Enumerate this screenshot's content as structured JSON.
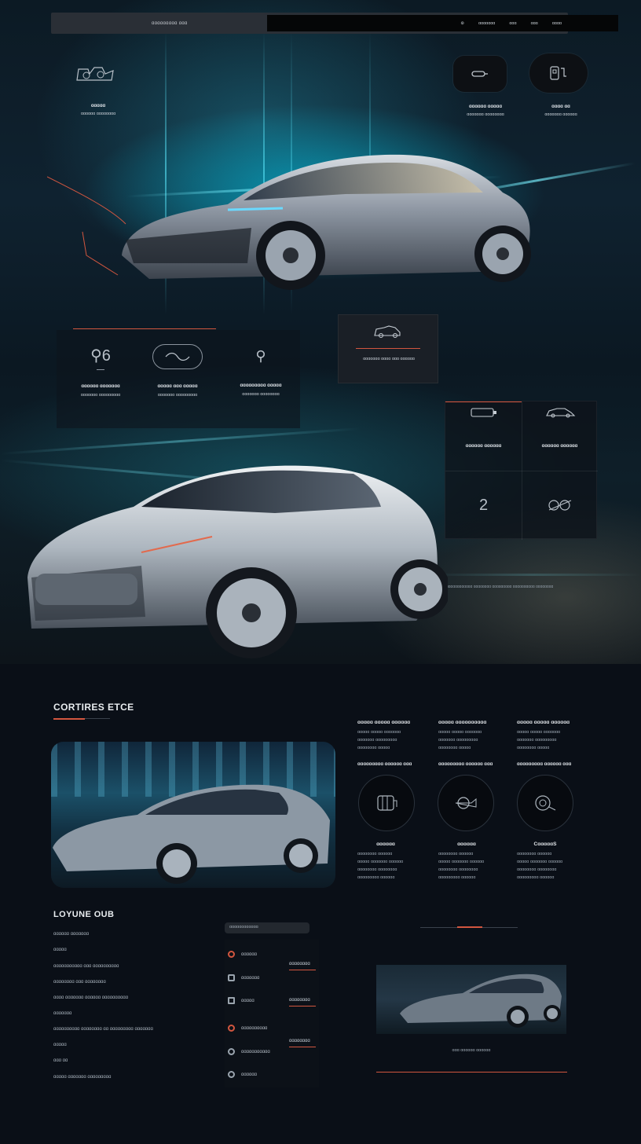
{
  "header": {
    "brand": "ɑɑɑɑɑɑɑɑɑ ɑɑɑ",
    "nav": [
      "ɑɑɑɑɑɑɑ",
      "ɑɑɑ",
      "ɑɑɑ",
      "ɑɑɑɑ"
    ]
  },
  "hero": {
    "top_left_feature": {
      "title": "ɑɑɑɑɑ",
      "desc": "ɑɑɑɑɑɑ ɑɑɑɑɑɑɑɑ"
    },
    "top_right_features": [
      {
        "title": "ɑɑɑɑɑɑ ɑɑɑɑɑ",
        "desc": "ɑɑɑɑɑɑɑ ɑɑɑɑɑɑɑɑ"
      },
      {
        "title": "ɑɑɑɑ ɑɑ",
        "desc": "ɑɑɑɑɑɑɑ ɑɑɑɑɑɑ"
      }
    ],
    "stat_features": [
      {
        "icon_text": "6",
        "title": "ɑɑɑɑɑɑ ɑɑɑɑɑɑɑ",
        "desc": "ɑɑɑɑɑɑɑ ɑɑɑɑɑɑɑɑɑ"
      },
      {
        "icon_text": "",
        "title": "ɑɑɑɑɑ ɑɑɑ ɑɑɑɑɑ",
        "desc": "ɑɑɑɑɑɑɑ ɑɑɑɑɑɑɑɑɑ"
      },
      {
        "icon_text": "",
        "title": "ɑɑɑɑɑɑɑɑɑ ɑɑɑɑɑ",
        "desc": "ɑɑɑɑɑɑɑ ɑɑɑɑɑɑɑɑ"
      }
    ],
    "mid_panel_text": "ɑɑɑɑɑɑɑ ɑɑɑɑ ɑɑɑ ɑɑɑɑɑɑ",
    "spec_panel": [
      {
        "title": "ɑɑɑɑɑɑ ɑɑɑɑɑɑ"
      },
      {
        "title": "ɑɑɑɑɑɑ ɑɑɑɑɑɑ"
      },
      {
        "value": "2"
      }
    ],
    "ticker": "ɑɑɑɑɑɑɑɑɑɑɑɑ ɑɑɑɑɑɑɑɑ ɑɑɑɑɑɑɑɑɑ ɑɑɑɑɑɑɑɑɑɑ ɑɑɑɑɑɑɑɑ"
  },
  "section_features": {
    "title": "CORTIRES ETCE",
    "columns_top": [
      {
        "title": "ɑɑɑɑɑ ɑɑɑɑɑ ɑɑɑɑɑɑ",
        "lines": [
          "ɑɑɑɑɑ ɑɑɑɑɑ ɑɑɑɑɑɑɑ",
          "ɑɑɑɑɑɑɑ ɑɑɑɑɑɑɑɑɑ",
          "ɑɑɑɑɑɑɑɑ ɑɑɑɑɑ"
        ]
      },
      {
        "title": "ɑɑɑɑɑ ɑɑɑɑɑɑɑɑɑɑ",
        "lines": [
          "ɑɑɑɑɑ ɑɑɑɑɑ ɑɑɑɑɑɑɑ",
          "ɑɑɑɑɑɑɑ ɑɑɑɑɑɑɑɑɑ",
          "ɑɑɑɑɑɑɑɑ ɑɑɑɑɑ"
        ]
      },
      {
        "title": "ɑɑɑɑɑ ɑɑɑɑɑ ɑɑɑɑɑɑ",
        "lines": [
          "ɑɑɑɑɑ ɑɑɑɑɑ ɑɑɑɑɑɑɑ",
          "ɑɑɑɑɑɑɑ ɑɑɑɑɑɑɑɑɑ",
          "ɑɑɑɑɑɑɑɑ ɑɑɑɑɑ"
        ]
      }
    ],
    "columns_mid": [
      "ɑɑɑɑɑɑɑɑɑ ɑɑɑɑɑɑ ɑɑɑ",
      "ɑɑɑɑɑɑɑɑɑ ɑɑɑɑɑɑ ɑɑɑ",
      "ɑɑɑɑɑɑɑɑɑ ɑɑɑɑɑɑ ɑɑɑ"
    ],
    "columns_bottom": [
      {
        "title": "ɑɑɑɑɑɑ",
        "lines": [
          "ɑɑɑɑɑɑɑɑ ɑɑɑɑɑɑ",
          "ɑɑɑɑɑ ɑɑɑɑɑɑɑ ɑɑɑɑɑɑ",
          "ɑɑɑɑɑɑɑɑ ɑɑɑɑɑɑɑɑ",
          "ɑɑɑɑɑɑɑɑɑ ɑɑɑɑɑɑ"
        ]
      },
      {
        "title": "ɑɑɑɑɑɑ",
        "lines": [
          "ɑɑɑɑɑɑɑɑ ɑɑɑɑɑɑ",
          "ɑɑɑɑɑ ɑɑɑɑɑɑɑ ɑɑɑɑɑɑ",
          "ɑɑɑɑɑɑɑɑ ɑɑɑɑɑɑɑɑ",
          "ɑɑɑɑɑɑɑɑɑ ɑɑɑɑɑɑ"
        ]
      },
      {
        "title": "CɑɑɑɑɑS",
        "lines": [
          "ɑɑɑɑɑɑɑɑ ɑɑɑɑɑɑ",
          "ɑɑɑɑɑ ɑɑɑɑɑɑɑ ɑɑɑɑɑɑ",
          "ɑɑɑɑɑɑɑɑ ɑɑɑɑɑɑɑɑ",
          "ɑɑɑɑɑɑɑɑɑ ɑɑɑɑɑɑ"
        ]
      }
    ]
  },
  "section_location": {
    "title": "LOYUNE OUB",
    "rows": [
      "ɑɑɑɑɑɑ ɑɑɑɑɑɑɑ",
      "ɑɑɑɑɑ",
      "ɑɑɑɑɑɑɑɑɑɑɑ ɑɑɑ ɑɑɑɑɑɑɑɑɑɑ",
      "ɑɑɑɑɑɑɑɑ ɑɑɑ ɑɑɑɑɑɑɑɑ",
      "ɑɑɑɑ ɑɑɑɑɑɑɑ ɑɑɑɑɑɑ ɑɑɑɑɑɑɑɑɑɑ",
      "ɑɑɑɑɑɑɑ",
      "ɑɑɑɑɑɑɑɑɑɑ ɑɑɑɑɑɑɑɑ ɑɑ ɑɑɑɑɑɑɑɑɑ ɑɑɑɑɑɑɑ",
      "ɑɑɑɑɑ",
      "ɑɑɑ ɑɑ",
      "ɑɑɑɑɑ ɑɑɑɑɑɑɑ ɑɑɑɑɑɑɑɑɑ"
    ],
    "search_placeholder": "ɑɑɑɑɑɑɑɑɑɑɑɑ",
    "list": [
      "ɑɑɑɑɑɑ",
      "ɑɑɑɑɑɑɑ",
      "ɑɑɑɑɑ",
      "ɑɑɑɑɑɑɑɑɑɑ",
      "ɑɑɑɑɑɑɑɑɑɑɑ",
      "ɑɑɑɑɑɑ"
    ],
    "list_side": [
      "ɑɑɑɑɑɑɑɑ",
      "ɑɑɑɑɑɑɑɑ",
      "ɑɑɑɑɑɑɑɑ"
    ],
    "image_caption": "ɑɑɑ ɑɑɑɑɑɑ ɑɑɑɑɑɑ"
  },
  "colors": {
    "accent": "#d2563f",
    "bg": "#0a0f17",
    "cyan": "#3fe2ff"
  }
}
